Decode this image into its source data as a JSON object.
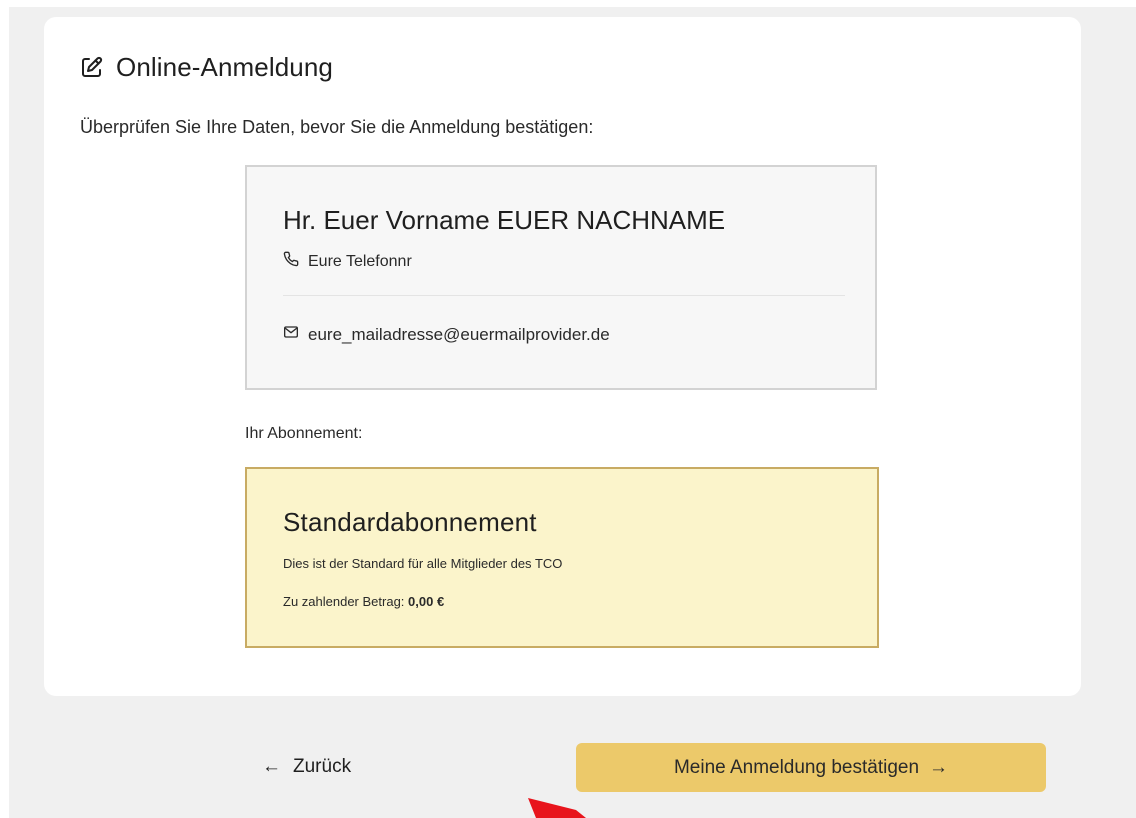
{
  "heading": {
    "icon": "edit-icon",
    "title": "Online-Anmeldung"
  },
  "intro_text": "Überprüfen Sie Ihre Daten, bevor Sie die Anmeldung bestätigen:",
  "contact": {
    "name": "Hr. Euer Vorname EUER NACHNAME",
    "phone_icon": "phone-icon",
    "phone": "Eure Telefonnr",
    "email_icon": "mail-icon",
    "email": "eure_mailadresse@euermailprovider.de"
  },
  "subscription": {
    "label": "Ihr Abonnement:",
    "title": "Standardabonnement",
    "description": "Dies ist der Standard für alle Mitglieder des TCO",
    "amount_label": "Zu zahlender Betrag: ",
    "amount_value": "0,00 €"
  },
  "actions": {
    "back_arrow": "←",
    "back_label": "Zurück",
    "confirm_label": "Meine Anmeldung bestätigen",
    "confirm_arrow": "→"
  },
  "colors": {
    "page_background": "#f0f0f0",
    "card_background": "#ffffff",
    "contact_box_background": "#f7f7f7",
    "subscription_box_background": "#fbf4cb",
    "subscription_box_border": "#c8ab63",
    "confirm_button": "#ecc96a",
    "pointer_arrow": "#e8141c"
  }
}
